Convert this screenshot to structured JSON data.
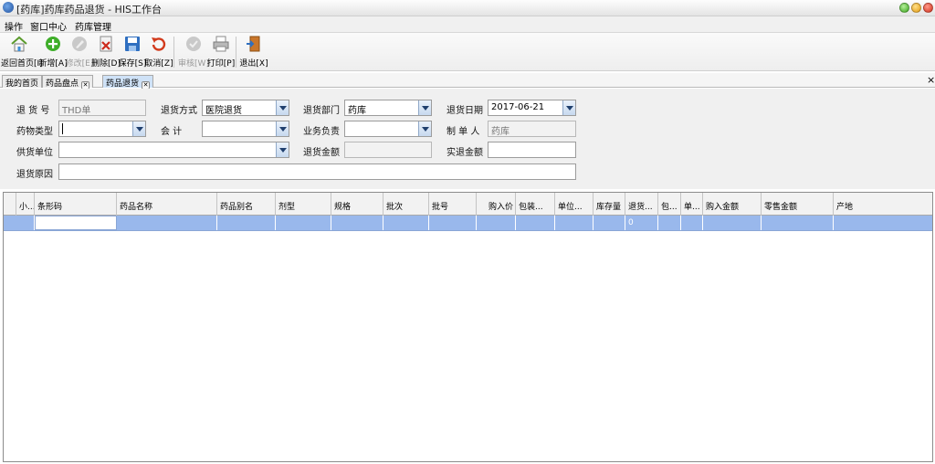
{
  "window": {
    "title": "[药库]药库药品退货 - HIS工作台"
  },
  "menu": [
    "操作",
    "窗口中心",
    "药库管理"
  ],
  "toolbar": {
    "buttons": [
      {
        "label": "返回首页[I]",
        "icon": "home-icon",
        "enabled": true
      },
      {
        "label": "新增[A]",
        "icon": "add-icon",
        "enabled": true
      },
      {
        "label": "修改[E]",
        "icon": "edit-icon",
        "enabled": false
      },
      {
        "label": "删除[D]",
        "icon": "delete-icon",
        "enabled": true
      },
      {
        "label": "保存[S]",
        "icon": "save-icon",
        "enabled": true
      },
      {
        "label": "取消[Z]",
        "icon": "undo-icon",
        "enabled": true
      },
      {
        "label": "审核[W]",
        "icon": "approve-icon",
        "enabled": false
      },
      {
        "label": "打印[P]",
        "icon": "print-icon",
        "enabled": true
      },
      {
        "label": "退出[X]",
        "icon": "exit-icon",
        "enabled": true
      }
    ]
  },
  "tabs": [
    {
      "label": "我的首页",
      "closable": false,
      "active": false
    },
    {
      "label": "药品盘点",
      "closable": true,
      "active": false
    },
    {
      "label": "药品退货",
      "closable": true,
      "active": true
    }
  ],
  "tab_strip_close": "×",
  "form": {
    "return_no": {
      "label": "退 货 号",
      "value": "THD单"
    },
    "return_method": {
      "label": "退货方式",
      "value": "医院退货"
    },
    "return_dept": {
      "label": "退货部门",
      "value": "药库"
    },
    "return_date": {
      "label": "退货日期",
      "value": "2017-06-21"
    },
    "item_type": {
      "label": "药物类型",
      "value": ""
    },
    "accounting": {
      "label": "会      计",
      "value": ""
    },
    "business_owner": {
      "label": "业务负责",
      "value": ""
    },
    "operator": {
      "label": "制 单 人",
      "value": "药库"
    },
    "supplier": {
      "label": "供货单位",
      "value": ""
    },
    "return_amount": {
      "label": "退货金额",
      "value": ""
    },
    "actual_amount": {
      "label": "实退金额",
      "value": ""
    },
    "reason": {
      "label": "退货原因",
      "value": ""
    }
  },
  "grid": {
    "columns": [
      "小...",
      "条形码",
      "药品名称",
      "药品别名",
      "剂型",
      "规格",
      "批次",
      "批号",
      "购入价",
      "包装...",
      "单位...",
      "库存量",
      "退货...",
      "包...",
      "单...",
      "购入金额",
      "零售金额",
      "产地"
    ],
    "rows": [
      {
        "marker": "›",
        "cells": [
          "",
          "",
          "",
          "",
          "",
          "",
          "",
          "",
          "",
          "",
          "",
          "",
          "0",
          "",
          "",
          "",
          "",
          ""
        ]
      }
    ]
  }
}
